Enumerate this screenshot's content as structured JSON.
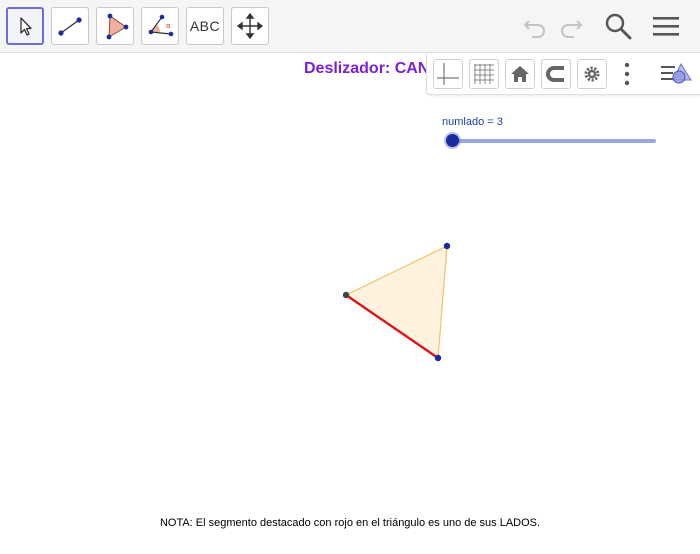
{
  "toolbar": {
    "tools": [
      {
        "name": "move-tool",
        "icon": "arrow-cursor-icon"
      },
      {
        "name": "segment-tool",
        "icon": "segment-icon"
      },
      {
        "name": "polygon-tool",
        "icon": "triangle-icon"
      },
      {
        "name": "angle-tool",
        "icon": "angle-icon"
      },
      {
        "name": "text-tool",
        "icon": "text-icon",
        "label": "ABC"
      },
      {
        "name": "move-graphics-tool",
        "icon": "move-arrows-icon"
      }
    ],
    "right_icons": [
      "undo-icon",
      "redo-icon",
      "search-icon",
      "menu-icon"
    ]
  },
  "slider_title": "Deslizador: CAN",
  "stylebar": {
    "buttons": [
      "axes-icon",
      "grid-icon",
      "home-icon",
      "magnet-icon",
      "gear-icon",
      "more-vertical-icon",
      "stylebar-toggle-icon"
    ]
  },
  "slider": {
    "label": "numlado = 3",
    "fraction": 0.0
  },
  "colors": {
    "accent": "#6d6dd8",
    "slider_title": "#7a1fd6",
    "triangle_fill": "#fff1dc",
    "triangle_edge": "#f3c266",
    "highlight_side": "#e0121a",
    "point": "#1b2a9e"
  },
  "note": "NOTA: El segmento destacado con rojo en el triángulo es uno de sus LADOS."
}
